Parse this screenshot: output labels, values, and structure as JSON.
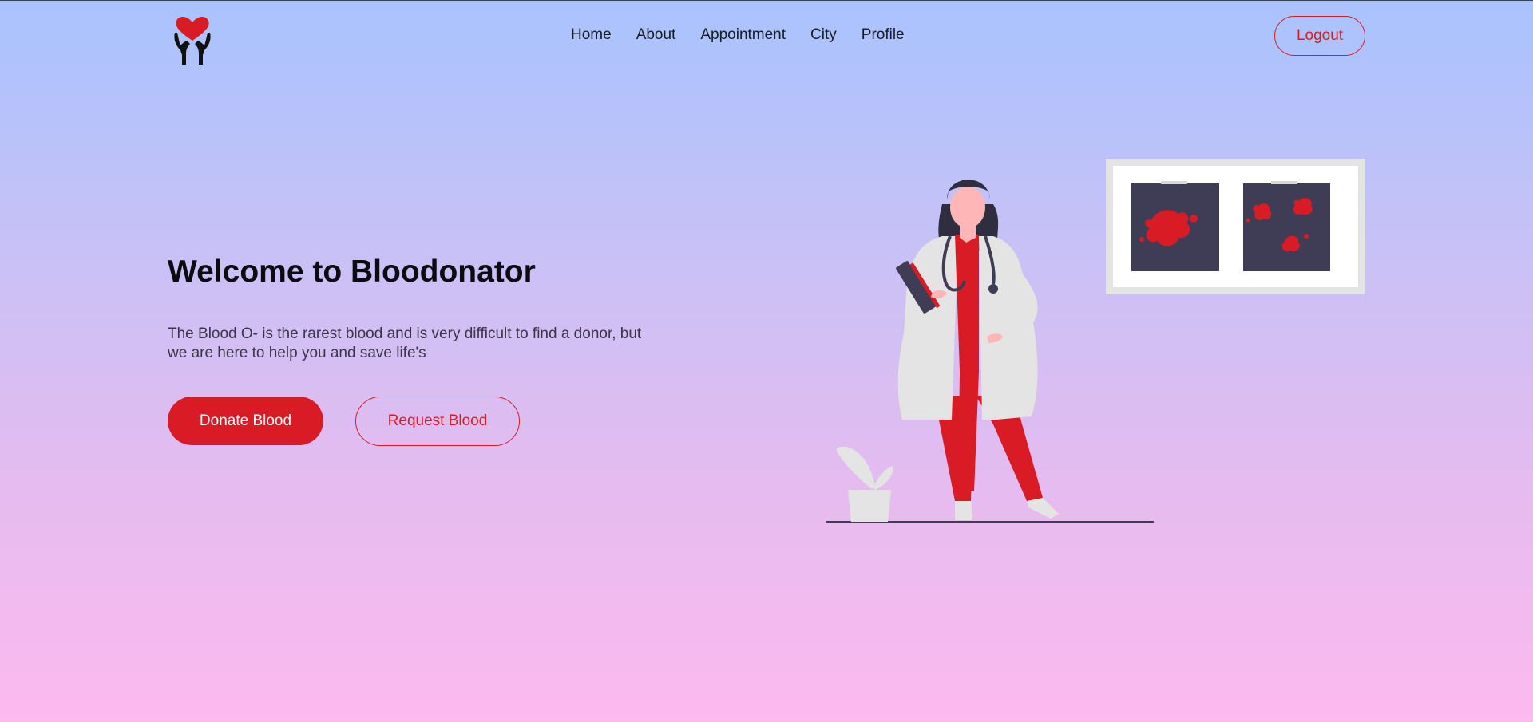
{
  "nav": {
    "logo_icon": "heart-in-hands-icon",
    "items": [
      {
        "label": "Home"
      },
      {
        "label": "About"
      },
      {
        "label": "Appointment"
      },
      {
        "label": "City"
      },
      {
        "label": "Profile"
      }
    ],
    "logout_label": "Logout"
  },
  "hero": {
    "title": "Welcome to Bloodonator",
    "text": "The Blood O- is the rarest blood and is very difficult to find a donor, but we are here to help you and save life's",
    "donate_label": "Donate Blood",
    "request_label": "Request Blood"
  },
  "illustration": {
    "name": "doctor-with-blood-samples-illustration"
  },
  "colors": {
    "accent": "#d81b24",
    "dark": "#3f3d56",
    "gradient_top": "#a9c3fe",
    "gradient_bottom": "#fcbaef"
  }
}
